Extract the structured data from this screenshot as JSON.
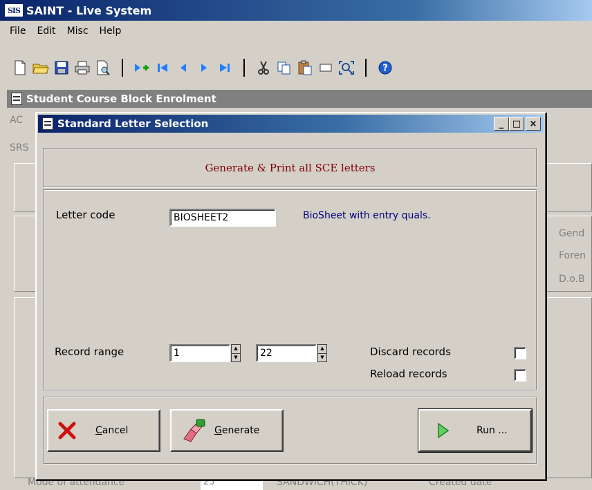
{
  "app": {
    "logo_text": "SIS",
    "title": "SAINT - Live System",
    "menu": [
      "File",
      "Edit",
      "Misc",
      "Help"
    ]
  },
  "toolbar": {
    "icons": [
      "new-document-icon",
      "open-folder-icon",
      "save-icon",
      "print-icon",
      "print-preview-icon",
      "add-record-icon",
      "first-record-icon",
      "previous-record-icon",
      "next-record-icon",
      "last-record-icon",
      "cut-icon",
      "copy-icon",
      "paste-icon",
      "clear-icon",
      "zoom-icon",
      "help-icon"
    ]
  },
  "form": {
    "title": "Student Course Block Enrolment",
    "partial_labels": [
      "AC",
      "SRS",
      "Gend",
      "Foren",
      "D.o.B"
    ],
    "bottom_row": {
      "label": "Mode of attendance",
      "value": "23",
      "mode": "SANDWICH(THICK)",
      "created": "Created date"
    }
  },
  "dialog": {
    "title": "Standard Letter Selection",
    "window_buttons": {
      "minimize": "_",
      "maximize": "□",
      "close": "×"
    },
    "header": "Generate & Print all SCE letters",
    "letter_code_label": "Letter code",
    "letter_code_value": "BIOSHEET2",
    "letter_description": "BioSheet with entry quals.",
    "record_range_label": "Record range",
    "range_from": "1",
    "range_to": "22",
    "discard_label": "Discard records",
    "reload_label": "Reload records",
    "discard_checked": false,
    "reload_checked": false,
    "buttons": {
      "cancel_first": "C",
      "cancel_rest": "ancel",
      "generate_first": "G",
      "generate_rest": "enerate",
      "run": "Run ..."
    }
  }
}
